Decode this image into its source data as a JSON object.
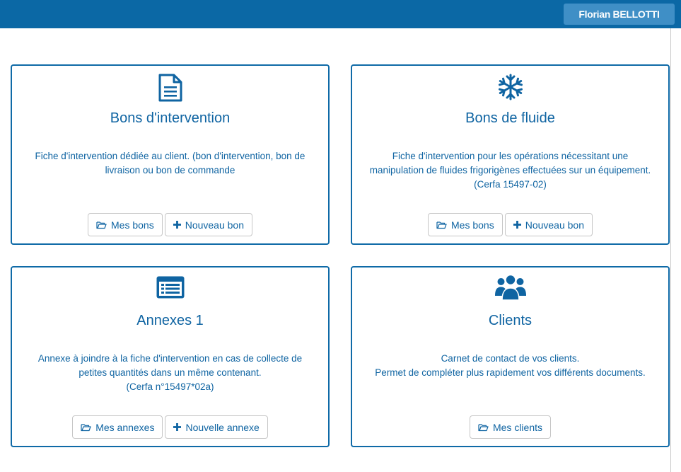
{
  "header": {
    "user_name": "Florian BELLOTTI"
  },
  "theme": {
    "primary": "#0b68a5",
    "text": "#0f64a2",
    "user_button": "#3f8fc6"
  },
  "cards": [
    {
      "icon": "document-icon",
      "title": "Bons d'intervention",
      "desc": [
        "Fiche d'intervention dédiée au client. (bon d'intervention, bon de",
        "livraison ou bon de commande"
      ],
      "buttons": [
        {
          "icon": "folder-open-icon",
          "label": "Mes bons"
        },
        {
          "icon": "plus-icon",
          "label": "Nouveau bon"
        }
      ]
    },
    {
      "icon": "snowflake-icon",
      "title": "Bons de fluide",
      "desc": [
        "Fiche d'intervention pour les opérations nécessitant une",
        "manipulation de fluides frigorigènes effectuées sur un équipement.",
        "(Cerfa 15497-02)"
      ],
      "buttons": [
        {
          "icon": "folder-open-icon",
          "label": "Mes bons"
        },
        {
          "icon": "plus-icon",
          "label": "Nouveau bon"
        }
      ]
    },
    {
      "icon": "list-alt-icon",
      "title": "Annexes 1",
      "desc": [
        "Annexe à joindre à la fiche d'intervention en cas de collecte de",
        "petites quantités dans un même contenant.",
        "(Cerfa n°15497*02a)"
      ],
      "buttons": [
        {
          "icon": "folder-open-icon",
          "label": "Mes annexes"
        },
        {
          "icon": "plus-icon",
          "label": "Nouvelle annexe"
        }
      ]
    },
    {
      "icon": "users-icon",
      "title": "Clients",
      "desc": [
        "Carnet de contact de vos clients.",
        "Permet de compléter plus rapidement vos différents documents."
      ],
      "buttons": [
        {
          "icon": "folder-open-icon",
          "label": "Mes clients"
        }
      ]
    }
  ]
}
